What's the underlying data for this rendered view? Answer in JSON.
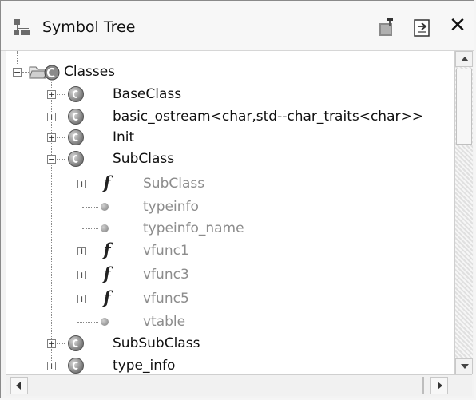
{
  "panel": {
    "title": "Symbol Tree",
    "title_icon": "symbol-tree-icon",
    "toolbar": [
      {
        "name": "pin-icon"
      },
      {
        "name": "sync-icon"
      },
      {
        "name": "close-icon",
        "glyph": "✕"
      }
    ]
  },
  "tree": {
    "root": {
      "label": "Classes",
      "icon": "classes-folder-icon",
      "expanded": true
    },
    "classes": [
      {
        "label": "BaseClass",
        "expanded": false
      },
      {
        "label": "basic_ostream<char,std--char_traits<char>>",
        "expanded": false
      },
      {
        "label": "Init",
        "expanded": false
      },
      {
        "label": "SubClass",
        "expanded": true
      },
      {
        "label": "SubSubClass",
        "expanded": false
      },
      {
        "label": "type_info",
        "expanded": false
      }
    ],
    "subclass_members": [
      {
        "label": "SubClass",
        "kind": "function",
        "expandable": true
      },
      {
        "label": "typeinfo",
        "kind": "variable",
        "expandable": false
      },
      {
        "label": "typeinfo_name",
        "kind": "variable",
        "expandable": false
      },
      {
        "label": "vfunc1",
        "kind": "function",
        "expandable": true
      },
      {
        "label": "vfunc3",
        "kind": "function",
        "expandable": true
      },
      {
        "label": "vfunc5",
        "kind": "function",
        "expandable": true
      },
      {
        "label": "vtable",
        "kind": "variable",
        "expandable": false
      }
    ]
  },
  "colors": {
    "member_text": "#8c8c8c",
    "class_text": "#111111"
  }
}
